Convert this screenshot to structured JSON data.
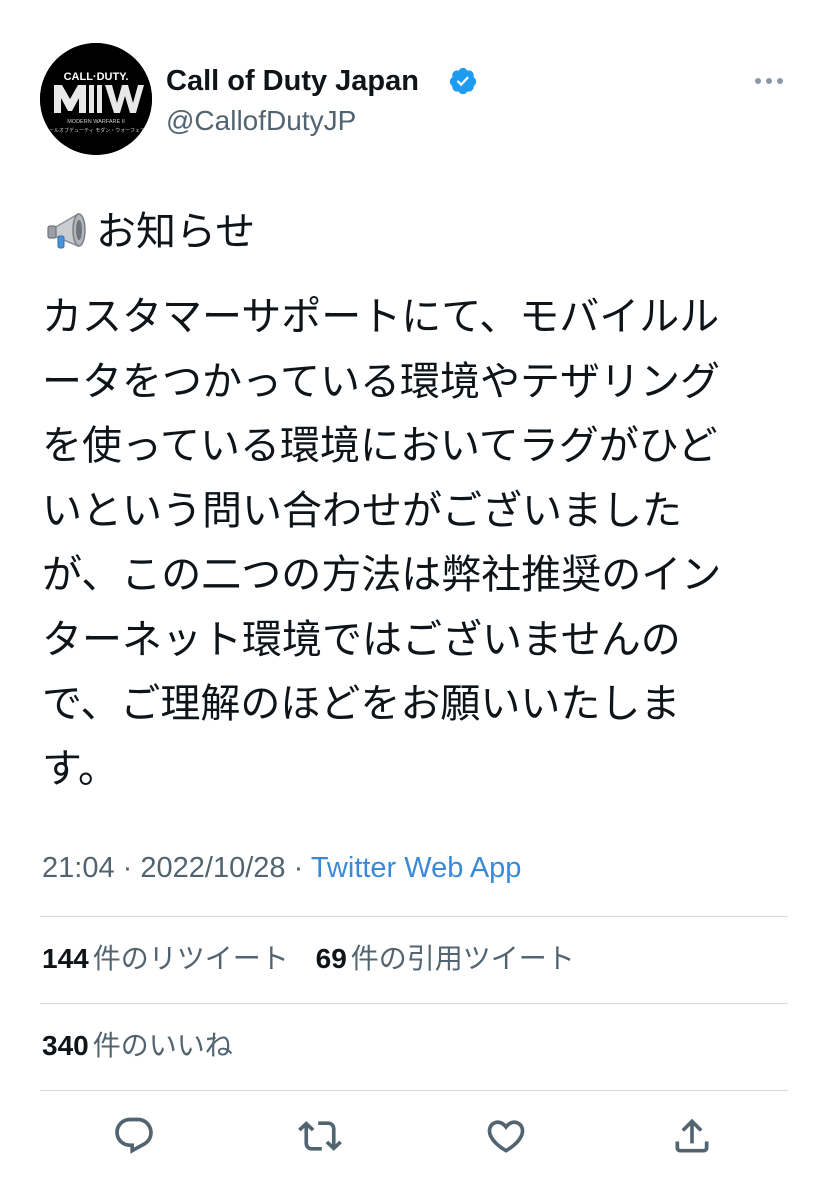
{
  "user": {
    "display_name": "Call of Duty Japan",
    "handle": "@CallofDutyJP",
    "verified": true,
    "avatar_logo": {
      "line1": "CALL·DUTY.",
      "line2": "MW",
      "line3": "MODERN WARFARE II",
      "line4": "コールオブデューティ モダン・ウォーフェアII"
    }
  },
  "tweet": {
    "heading_emoji": "megaphone-icon",
    "heading": "お知らせ",
    "body_lines": [
      "カスタマーサポートにて、モバイルル",
      "ータをつかっている環境やテザリング",
      "を使っている環境においてラグがひど",
      "いという問い合わせがございました",
      "が、この二つの方法は弊社推奨のイン",
      "ターネット環境ではございませんの",
      "で、ご理解のほどをお願いいたしま",
      "す。"
    ],
    "time": "21:04",
    "separator": "·",
    "date": "2022/10/28",
    "source": "Twitter Web App"
  },
  "stats": {
    "retweets_count": "144",
    "retweets_label": "件のリツイート",
    "quotes_count": "69",
    "quotes_label": "件の引用ツイート",
    "likes_count": "340",
    "likes_label": "件のいいね"
  },
  "actions": [
    "reply-icon",
    "retweet-icon",
    "like-icon",
    "share-icon"
  ],
  "colors": {
    "text": "#0f1419",
    "secondary": "#536471",
    "link": "#3b8ad8",
    "verified": "#1d9bf0",
    "divider": "#d4dbe0",
    "icon": "#536471"
  }
}
